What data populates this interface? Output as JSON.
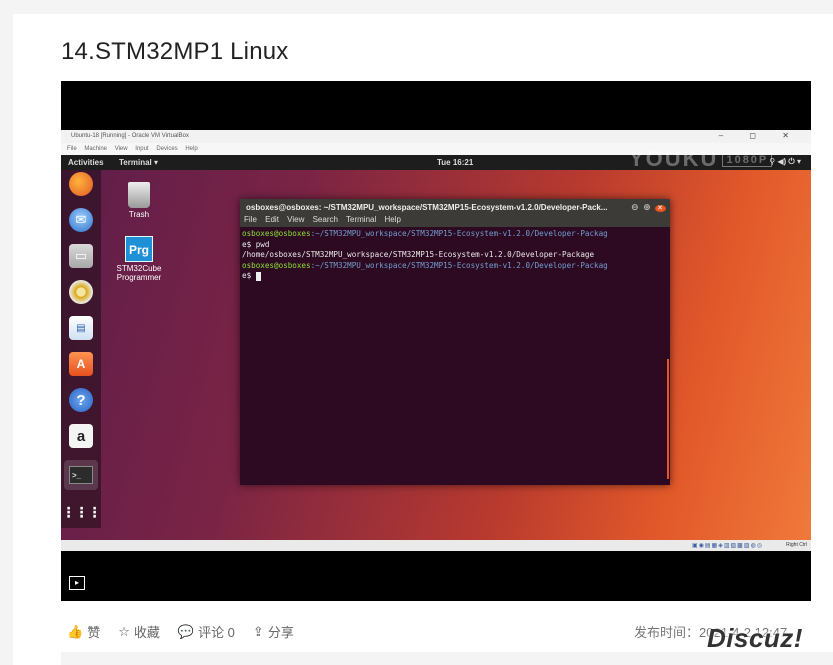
{
  "post": {
    "title": "14.STM32MP1 Linux",
    "actions": [
      {
        "icon": "thumbs-up-icon",
        "glyph": "👍",
        "label": "赞"
      },
      {
        "icon": "star-icon",
        "glyph": "☆",
        "label": "收藏"
      },
      {
        "icon": "comment-icon",
        "glyph": "💬",
        "label": "评论 0"
      },
      {
        "icon": "share-icon",
        "glyph": "⇪",
        "label": "分享"
      }
    ],
    "published": "发布时间：2021-4-2 12:47"
  },
  "watermark": {
    "site": "Discuz!"
  },
  "video": {
    "youku": {
      "text": "YOUKU",
      "tag": "1080P"
    },
    "vbox": {
      "title": "Ubuntu-18 [Running] - Oracle VM VirtualBox",
      "controls": "–  ◻  ✕",
      "menu": [
        "File",
        "Machine",
        "View",
        "Input",
        "Devices",
        "Help"
      ],
      "status_right": "Right Ctrl"
    },
    "ubuntu": {
      "activities": "Activities",
      "app_menu": "Terminal ▾",
      "clock": "Tue 16:21",
      "tray": "⚲ ◀) ⏻ ▾"
    },
    "desktop": {
      "trash": "Trash",
      "programmer": "STM32Cube Programmer",
      "programmer_icon_text": "Prg"
    },
    "terminal": {
      "title": "osboxes@osboxes: ~/STM32MPU_workspace/STM32MP15-Ecosystem-v1.2.0/Developer-Pack...",
      "menu": [
        "File",
        "Edit",
        "View",
        "Search",
        "Terminal",
        "Help"
      ],
      "lines": [
        {
          "user": "osboxes@osboxes",
          "path": ":~/STM32MPU_workspace/STM32MP15-Ecosystem-v1.2.0/Developer-Packag"
        },
        {
          "text": "e$ pwd"
        },
        {
          "text": "/home/osboxes/STM32MPU_workspace/STM32MP15-Ecosystem-v1.2.0/Developer-Package"
        },
        {
          "user": "osboxes@osboxes",
          "path": ":~/STM32MPU_workspace/STM32MP15-Ecosystem-v1.2.0/Developer-Packag"
        },
        {
          "text": "e$ "
        }
      ]
    }
  }
}
